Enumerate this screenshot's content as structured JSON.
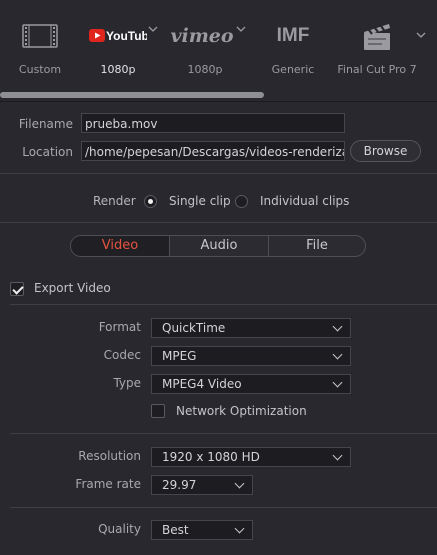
{
  "presets": [
    {
      "label": "Custom",
      "icon": "film-strip-icon"
    },
    {
      "label": "1080p",
      "icon": "youtube-icon",
      "logo_text": "YouTube"
    },
    {
      "label": "1080p",
      "icon": "vimeo-icon",
      "logo_text": "vimeo"
    },
    {
      "label": "Generic",
      "icon": "imf-icon",
      "logo_text": "IMF"
    },
    {
      "label": "Final Cut Pro 7",
      "icon": "clapperboard-icon"
    }
  ],
  "file": {
    "filename_label": "Filename",
    "filename_value": "prueba.mov",
    "location_label": "Location",
    "location_value": "/home/pepesan/Descargas/videos-renderizado",
    "browse_label": "Browse"
  },
  "render": {
    "label": "Render",
    "options": [
      "Single clip",
      "Individual clips"
    ],
    "selected": "Single clip"
  },
  "tabs": [
    "Video",
    "Audio",
    "File"
  ],
  "active_tab": "Video",
  "export_video": {
    "label": "Export Video",
    "checked": true
  },
  "video": {
    "format_label": "Format",
    "format_value": "QuickTime",
    "codec_label": "Codec",
    "codec_value": "MPEG",
    "type_label": "Type",
    "type_value": "MPEG4 Video",
    "network_opt_label": "Network Optimization",
    "network_opt_checked": false,
    "resolution_label": "Resolution",
    "resolution_value": "1920 x 1080 HD",
    "framerate_label": "Frame rate",
    "framerate_value": "29.97",
    "quality_label": "Quality",
    "quality_value": "Best"
  },
  "colors": {
    "accent": "#e5533e",
    "background": "#28282e"
  }
}
